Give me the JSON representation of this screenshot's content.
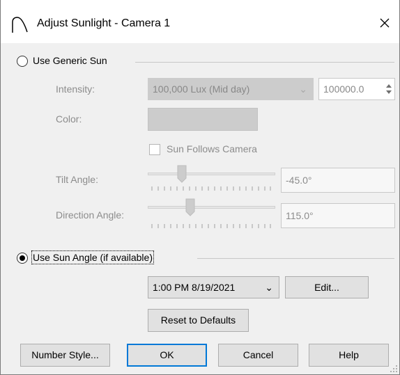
{
  "window": {
    "title": "Adjust Sunlight - Camera 1",
    "icon": "arch-icon",
    "close_icon": "close-icon"
  },
  "generic_sun": {
    "label": "Use Generic Sun",
    "selected": false,
    "intensity_label": "Intensity:",
    "intensity_preset": "100,000 Lux (Mid day)",
    "intensity_value": "100000.0",
    "color_label": "Color:",
    "sun_follows_camera_label": "Sun Follows Camera",
    "sun_follows_camera_checked": false,
    "tilt_label": "Tilt Angle:",
    "tilt_value": "-45.0°",
    "direction_label": "Direction Angle:",
    "direction_value": "115.0°"
  },
  "sun_angle": {
    "label": "Use Sun Angle (if available)",
    "selected": true,
    "datetime": "1:00 PM 8/19/2021",
    "edit_label": "Edit...",
    "reset_label": "Reset to Defaults"
  },
  "footer": {
    "number_style_label": "Number Style...",
    "ok_label": "OK",
    "cancel_label": "Cancel",
    "help_label": "Help"
  },
  "colors": {
    "accent": "#0078d7",
    "disabled_text": "#8c8c8c",
    "disabled_fill": "#cccccc"
  }
}
